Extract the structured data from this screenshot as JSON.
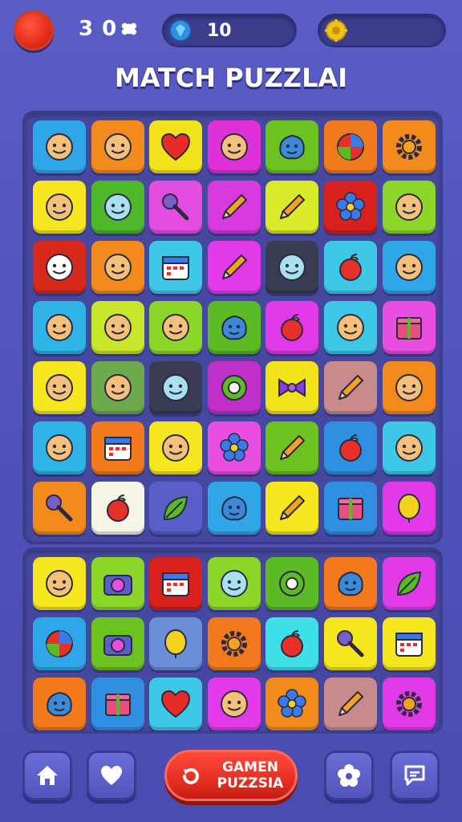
{
  "header": {
    "level_text": "3 0",
    "gems_value": "10",
    "coins_value": "",
    "title": "MATCH PUZZLAI"
  },
  "colors": {
    "background": "#5a5dc4",
    "board": "#46479e",
    "play_button": "#e02c20",
    "gem": "#2f8fe0",
    "coin": "#f2c21a"
  },
  "main_board": {
    "rows": [
      [
        {
          "icon": "boy-face-icon",
          "color": "#2fa6e8"
        },
        {
          "icon": "girl-face-icon",
          "color": "#f28a1c"
        },
        {
          "icon": "heart-icon",
          "color": "#f2e21a"
        },
        {
          "icon": "elf-face-icon",
          "color": "#e030d8"
        },
        {
          "icon": "blob-monster-icon",
          "color": "#6cc21e"
        },
        {
          "icon": "ball-icon",
          "color": "#f07a1c"
        },
        {
          "icon": "gear-icon",
          "color": "#f28a1c"
        }
      ],
      [
        {
          "icon": "girl-face-icon",
          "color": "#f5e61e"
        },
        {
          "icon": "robot-face-icon",
          "color": "#4fb82a"
        },
        {
          "icon": "key-icon",
          "color": "#e44ee0"
        },
        {
          "icon": "pencil-icon",
          "color": "#d83ae0"
        },
        {
          "icon": "pencil-icon",
          "color": "#d8ea2a"
        },
        {
          "icon": "flower-icon",
          "color": "#d8201c"
        },
        {
          "icon": "pig-face-icon",
          "color": "#8cd62a"
        }
      ],
      [
        {
          "icon": "ghost-face-icon",
          "color": "#d82a1c"
        },
        {
          "icon": "cat-face-icon",
          "color": "#f28a1c"
        },
        {
          "icon": "id-card-icon",
          "color": "#3ec8e8"
        },
        {
          "icon": "pencil-icon",
          "color": "#e23ae8"
        },
        {
          "icon": "alien-face-icon",
          "color": "#3a3c54"
        },
        {
          "icon": "apple-icon",
          "color": "#3ec8e8"
        },
        {
          "icon": "lemon-face-icon",
          "color": "#2fa6e8"
        }
      ],
      [
        {
          "icon": "smiley-face-icon",
          "color": "#2fb4e8"
        },
        {
          "icon": "smiley-face-icon",
          "color": "#c8e62a"
        },
        {
          "icon": "smiley-face-icon",
          "color": "#8cd62a"
        },
        {
          "icon": "blob-monster-icon",
          "color": "#5cba24"
        },
        {
          "icon": "apple-icon",
          "color": "#e23ae8"
        },
        {
          "icon": "smiley-face-icon",
          "color": "#3ec8e8"
        },
        {
          "icon": "box-icon",
          "color": "#e84ee0"
        }
      ],
      [
        {
          "icon": "girl-face-icon",
          "color": "#f5e61e"
        },
        {
          "icon": "smiley-face-icon",
          "color": "#6caa4c"
        },
        {
          "icon": "robot-face-icon",
          "color": "#3a3c54"
        },
        {
          "icon": "ring-icon",
          "color": "#c030c8"
        },
        {
          "icon": "bow-icon",
          "color": "#f2e21a"
        },
        {
          "icon": "pencil-icon",
          "color": "#c88a8a"
        },
        {
          "icon": "drop-face-icon",
          "color": "#f28a1c"
        }
      ],
      [
        {
          "icon": "smiley-face-icon",
          "color": "#2fb4e8"
        },
        {
          "icon": "calendar-icon",
          "color": "#f27a1c"
        },
        {
          "icon": "leaf-face-icon",
          "color": "#f5e61e"
        },
        {
          "icon": "flower-bunch-icon",
          "color": "#e84ee0"
        },
        {
          "icon": "pencil-icon",
          "color": "#6cc21e"
        },
        {
          "icon": "cherry-icon",
          "color": "#2f8fe0"
        },
        {
          "icon": "elf-face-icon",
          "color": "#3ec8e8"
        }
      ],
      [
        {
          "icon": "magnifier-icon",
          "color": "#f28a1c"
        },
        {
          "icon": "apple-icon",
          "color": "#f5f5e6"
        },
        {
          "icon": "leaf-icon",
          "color": "#5a5ec8"
        },
        {
          "icon": "blob-monster-icon",
          "color": "#2fa6e8"
        },
        {
          "icon": "pencil-icon",
          "color": "#f5e61e"
        },
        {
          "icon": "gift-box-icon",
          "color": "#2f8fe0"
        },
        {
          "icon": "balloon-icon",
          "color": "#e23ae8"
        }
      ]
    ]
  },
  "lower_board": {
    "rows": [
      [
        {
          "icon": "smiley-face-icon",
          "color": "#f5e61e"
        },
        {
          "icon": "camera-icon",
          "color": "#8cd62a"
        },
        {
          "icon": "calendar-icon",
          "color": "#d8201c"
        },
        {
          "icon": "robot-face-icon",
          "color": "#8cd62a"
        },
        {
          "icon": "ring-icon",
          "color": "#5cba24"
        },
        {
          "icon": "blob-monster-icon",
          "color": "#f27a1c"
        },
        {
          "icon": "leaf-icon",
          "color": "#e23ae8"
        }
      ],
      [
        {
          "icon": "ball-icon",
          "color": "#2fa6e8"
        },
        {
          "icon": "camera-icon",
          "color": "#6cc21e"
        },
        {
          "icon": "lemon-icon",
          "color": "#6a8ed8"
        },
        {
          "icon": "sun-icon",
          "color": "#f27a1c"
        },
        {
          "icon": "apple-icon",
          "color": "#3ee0e8"
        },
        {
          "icon": "key-icon",
          "color": "#f5e61e"
        },
        {
          "icon": "clipboard-icon",
          "color": "#f5e61e"
        }
      ],
      [
        {
          "icon": "blob-monster-icon",
          "color": "#f27a1c"
        },
        {
          "icon": "box-icon",
          "color": "#2f8fe0"
        },
        {
          "icon": "heart-icon",
          "color": "#3ec8e8"
        },
        {
          "icon": "smiley-face-icon",
          "color": "#e23ae8"
        },
        {
          "icon": "flower-icon",
          "color": "#f28a1c"
        },
        {
          "icon": "pencil-icon",
          "color": "#c88a8a"
        },
        {
          "icon": "gear-icon",
          "color": "#e23ae8"
        }
      ]
    ]
  },
  "bottom_nav": {
    "home_icon": "home-icon",
    "favorites_icon": "heart-icon",
    "play_label_line1": "GAMEN",
    "play_label_line2": "PUZZSIA",
    "settings_icon": "flower-icon",
    "chat_icon": "chat-icon"
  }
}
